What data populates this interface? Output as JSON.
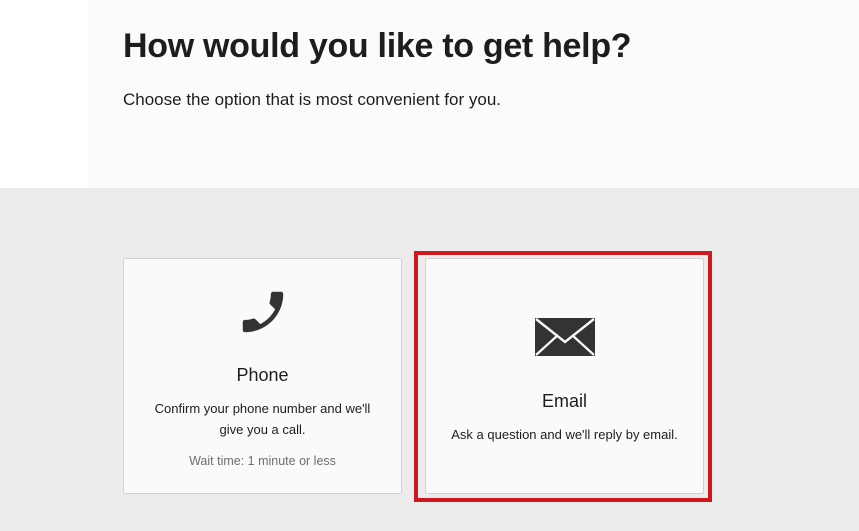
{
  "header": {
    "title": "How would you like to get help?",
    "subtitle": "Choose the option that is most convenient for you."
  },
  "options": [
    {
      "id": "phone",
      "icon": "phone-icon",
      "title": "Phone",
      "description": "Confirm your phone number and we'll give you a call.",
      "wait_time": "Wait time: 1 minute or less"
    },
    {
      "id": "email",
      "icon": "envelope-icon",
      "title": "Email",
      "description": "Ask a question and we'll reply by email.",
      "highlighted": true
    }
  ],
  "colors": {
    "highlight": "#d0161f",
    "icon": "#333333",
    "background": "#ececec"
  }
}
